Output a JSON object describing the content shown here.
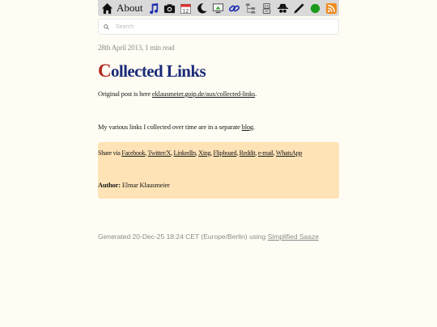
{
  "nav": {
    "about_label": "About",
    "items": [
      "home-icon",
      "music-note-icon",
      "camera-icon",
      "calendar-icon",
      "moon-icon",
      "monitor-icon",
      "link-icon",
      "tree-icon",
      "robot-icon",
      "spy-icon",
      "pencil-icon",
      "green-dot-icon",
      "rss-icon"
    ],
    "calendar_day": "12",
    "bar_color": "#d9d9d9"
  },
  "search": {
    "placeholder": "Search"
  },
  "post": {
    "meta": "28th April 2013, 1 min read",
    "title_initial": "C",
    "title_rest": "ollected Links",
    "intro_prefix": "Original post is here ",
    "intro_link": "eklausmeier.goip.de/aux/collected-links",
    "intro_suffix": ".",
    "body_prefix": "My various links I collected over time are in a separate ",
    "body_link": "blog",
    "body_suffix": "."
  },
  "share": {
    "label": "Share via ",
    "links": [
      "Facebook",
      "Twitter/X",
      "LinkedIn",
      "Xing",
      "Flipboard",
      "Reddit",
      "e-mail",
      "WhatsApp"
    ],
    "separator": ", ",
    "box_color": "#fee3b6"
  },
  "author": {
    "label": "Author:",
    "name": " Elmar Klausmeier"
  },
  "footer": {
    "text": "Generated 20-Dec-25 18:24 CET (Europe/Berlin) using ",
    "link": "Simplified Saaze"
  },
  "colors": {
    "background": "#fffdf3",
    "title": "#1b2a78",
    "initial": "#b22c22"
  }
}
